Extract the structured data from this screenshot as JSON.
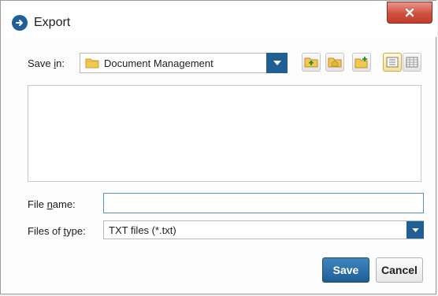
{
  "window": {
    "title": "Export",
    "app_icon": "arrow-right-circle-icon",
    "close_icon": "close-x-icon"
  },
  "save_in": {
    "label_pre": "Save ",
    "label_u": "i",
    "label_post": "n:",
    "value": "Document Management",
    "icon": "folder-icon"
  },
  "toolbar": {
    "buttons": [
      {
        "name": "up-one-level-icon"
      },
      {
        "name": "home-folder-icon"
      },
      {
        "name": "new-folder-icon"
      },
      {
        "name": "list-view-icon"
      },
      {
        "name": "details-view-icon"
      }
    ]
  },
  "file_name": {
    "label_pre": "File ",
    "label_u": "n",
    "label_post": "ame:",
    "value": "",
    "placeholder": ""
  },
  "file_type": {
    "label_pre": "Files of ",
    "label_u": "t",
    "label_post": "ype:",
    "value": "TXT files (*.txt)"
  },
  "actions": {
    "save_label": "Save",
    "cancel_label": "Cancel"
  },
  "colors": {
    "primary": "#1f5f93",
    "close_red": "#c94a3a",
    "folder_yellow": "#f2c94c"
  }
}
